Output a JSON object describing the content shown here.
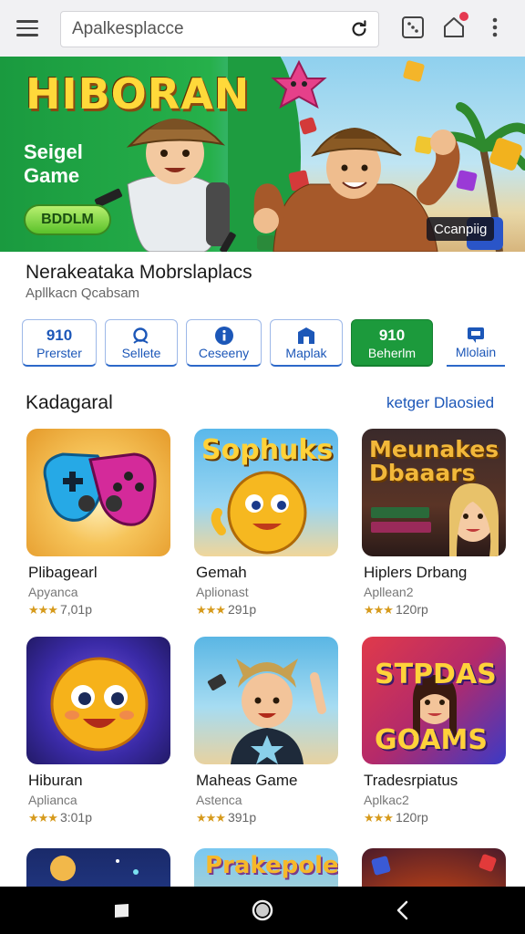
{
  "search": {
    "placeholder": "Apalkesplacce"
  },
  "banner": {
    "title": "HIBORAN",
    "subtitle": "Seigel Game",
    "button_label": "BDDLM",
    "corner_label": "Ccanpiig"
  },
  "app": {
    "title": "Nerakeataka Mobrslaplacs",
    "subtitle": "Apllkacn Qcabsam"
  },
  "chips": [
    {
      "top": "910",
      "label": "Prerster",
      "icon": null,
      "active": false
    },
    {
      "top": "",
      "label": "Sellete",
      "icon": "search-icon",
      "active": false
    },
    {
      "top": "",
      "label": "Ceseeny",
      "icon": "info-icon",
      "active": false
    },
    {
      "top": "",
      "label": "Maplak",
      "icon": "store-icon",
      "active": false
    },
    {
      "top": "910",
      "label": "Beherlm",
      "icon": null,
      "active": true
    },
    {
      "top": "",
      "label": "Mlolain",
      "icon": "chat-icon",
      "active": false
    }
  ],
  "section": {
    "title": "Kadagaral",
    "link": "ketger Dlaosied"
  },
  "cards": [
    {
      "name": "Plibagearl",
      "sub": "Apyanca",
      "rating": "7,01p",
      "thumb_text": ""
    },
    {
      "name": "Gemah",
      "sub": "Aplionast",
      "rating": "291p",
      "thumb_text": "Sophuks"
    },
    {
      "name": "Hiplers Drbang",
      "sub": "Apllean2",
      "rating": "120rp",
      "thumb_text": "Meunakes Dbaaars"
    },
    {
      "name": "Hiburan",
      "sub": "Aplianca",
      "rating": "3:01p",
      "thumb_text": ""
    },
    {
      "name": "Maheas Game",
      "sub": "Astenca",
      "rating": "391p",
      "thumb_text": ""
    },
    {
      "name": "Tradesrpiatus",
      "sub": "Aplkac2",
      "rating": "120rp",
      "thumb_text": "STPDAS GOAMS"
    },
    {
      "name": "",
      "sub": "",
      "rating": "",
      "thumb_text": ""
    },
    {
      "name": "",
      "sub": "",
      "rating": "",
      "thumb_text": "Prakepolers"
    },
    {
      "name": "",
      "sub": "",
      "rating": "",
      "thumb_text": ""
    }
  ],
  "stars": "★★★",
  "colors": {
    "accent_blue": "#1c57b8",
    "accent_green": "#1c9a3c",
    "badge_red": "#e53950",
    "star": "#d69a1c"
  },
  "icons": [
    "menu-icon",
    "reload-icon",
    "dice-icon",
    "home-icon",
    "more-icon",
    "recents-icon",
    "home-circle-icon",
    "back-icon"
  ]
}
